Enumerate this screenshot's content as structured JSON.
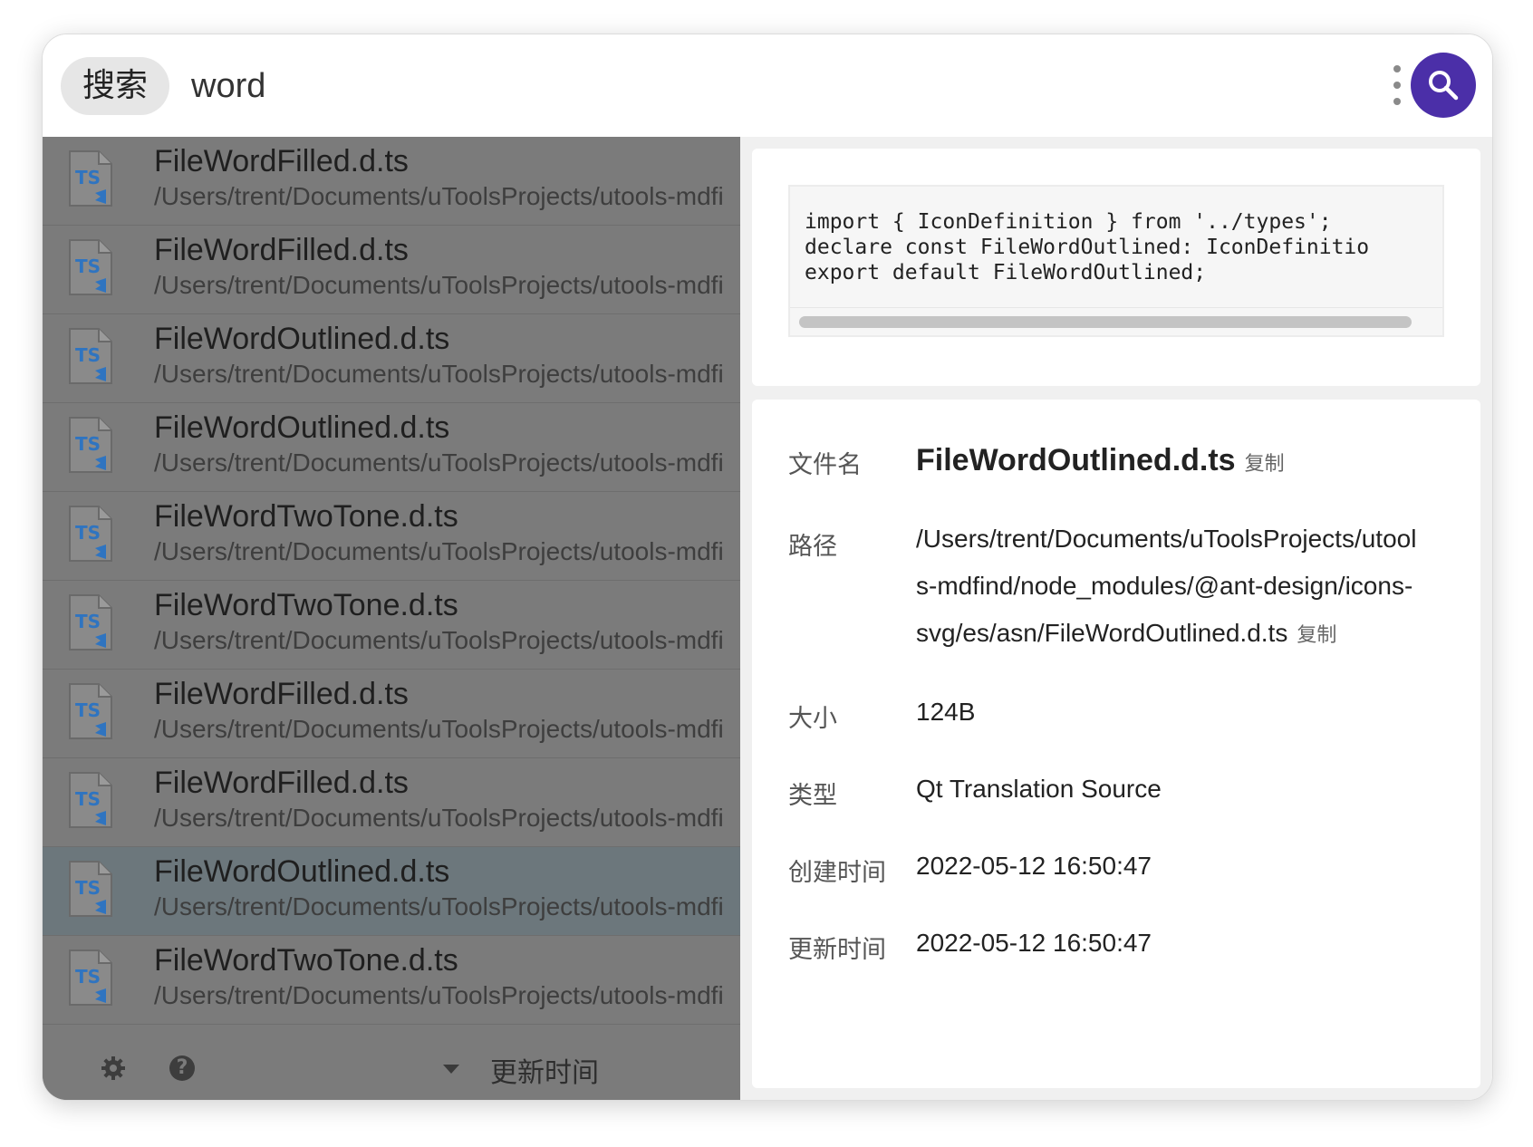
{
  "search": {
    "tag_label": "搜索",
    "query": "word"
  },
  "results": [
    {
      "name": "FileWordFilled.d.ts",
      "path": "/Users/trent/Documents/uToolsProjects/utools-mdfi",
      "icon": "ts-file-icon",
      "selected": false
    },
    {
      "name": "FileWordFilled.d.ts",
      "path": "/Users/trent/Documents/uToolsProjects/utools-mdfi",
      "icon": "ts-file-icon",
      "selected": false
    },
    {
      "name": "FileWordOutlined.d.ts",
      "path": "/Users/trent/Documents/uToolsProjects/utools-mdfi",
      "icon": "ts-file-icon",
      "selected": false
    },
    {
      "name": "FileWordOutlined.d.ts",
      "path": "/Users/trent/Documents/uToolsProjects/utools-mdfi",
      "icon": "ts-file-icon",
      "selected": false
    },
    {
      "name": "FileWordTwoTone.d.ts",
      "path": "/Users/trent/Documents/uToolsProjects/utools-mdfi",
      "icon": "ts-file-icon",
      "selected": false
    },
    {
      "name": "FileWordTwoTone.d.ts",
      "path": "/Users/trent/Documents/uToolsProjects/utools-mdfi",
      "icon": "ts-file-icon",
      "selected": false
    },
    {
      "name": "FileWordFilled.d.ts",
      "path": "/Users/trent/Documents/uToolsProjects/utools-mdfi",
      "icon": "ts-file-icon",
      "selected": false
    },
    {
      "name": "FileWordFilled.d.ts",
      "path": "/Users/trent/Documents/uToolsProjects/utools-mdfi",
      "icon": "ts-file-icon",
      "selected": false
    },
    {
      "name": "FileWordOutlined.d.ts",
      "path": "/Users/trent/Documents/uToolsProjects/utools-mdfi",
      "icon": "ts-file-icon",
      "selected": true
    },
    {
      "name": "FileWordTwoTone.d.ts",
      "path": "/Users/trent/Documents/uToolsProjects/utools-mdfi",
      "icon": "ts-file-icon",
      "selected": false
    }
  ],
  "footer": {
    "sort_label": "更新时间"
  },
  "preview": {
    "code_lines": [
      "import { IconDefinition } from '../types';",
      "declare const FileWordOutlined: IconDefinitio",
      "export default FileWordOutlined;"
    ]
  },
  "details": {
    "filename_label": "文件名",
    "filename": "FileWordOutlined.d.ts",
    "copy_label": "复制",
    "path_label": "路径",
    "path_lines": [
      "/Users/trent/Documents/uToolsProjects/utool",
      "s-mdfind/node_modules/@ant-design/icons-",
      "svg/es/asn/FileWordOutlined.d.ts"
    ],
    "size_label": "大小",
    "size": "124B",
    "type_label": "类型",
    "type": "Qt Translation Source",
    "created_label": "创建时间",
    "created": "2022-05-12 16:50:47",
    "modified_label": "更新时间",
    "modified": "2022-05-12 16:50:47"
  },
  "colors": {
    "accent": "#4b2fa8",
    "list_bg": "#7b7b7b",
    "selected_row": "#6c777c",
    "ts_icon_blue": "#2f74c0"
  }
}
